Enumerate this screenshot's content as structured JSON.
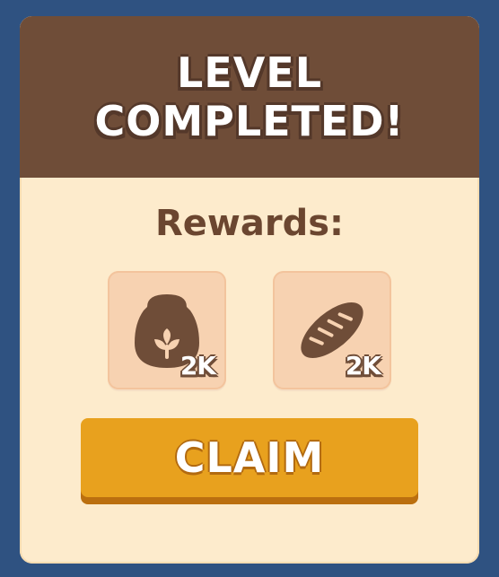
{
  "dialog": {
    "title_line1": "LEVEL",
    "title_line2": "COMPLETED!",
    "rewards_label": "Rewards:",
    "claim_label": "CLAIM"
  },
  "rewards": [
    {
      "icon": "flour-sack-icon",
      "amount": "2K"
    },
    {
      "icon": "bread-icon",
      "amount": "2K"
    }
  ],
  "colors": {
    "background": "#2f5281",
    "panel": "#fdebcc",
    "header": "#6f4d38",
    "tile": "#f7d2b1",
    "icon": "#6f4d38",
    "claim_button": "#e8a11e",
    "claim_shadow": "#bb6f0f",
    "rewards_text": "#6b4630"
  }
}
